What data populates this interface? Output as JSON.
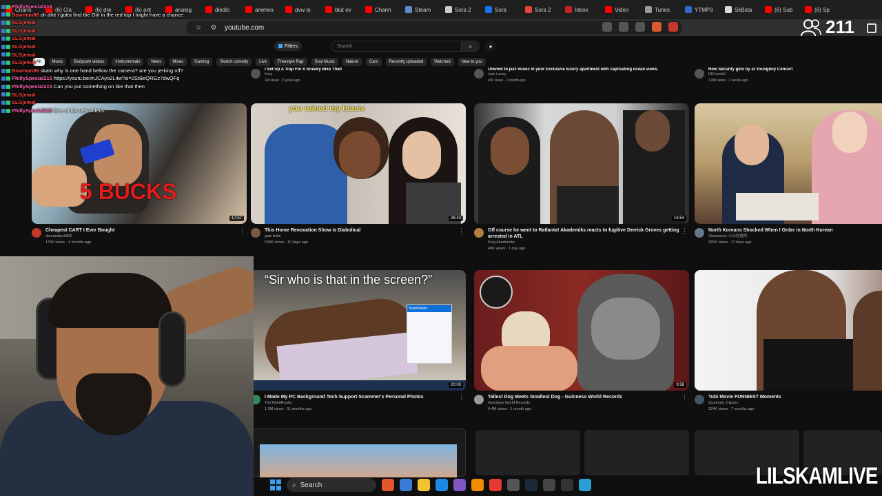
{
  "browser": {
    "tabs": [
      {
        "label": "Chann",
        "color": "#ff0000"
      },
      {
        "label": "(6) Cla",
        "color": "#ff0000"
      },
      {
        "label": "(6) dre",
        "color": "#ff0000"
      },
      {
        "label": "(6) ant",
        "color": "#ff0000"
      },
      {
        "label": "analog",
        "color": "#ff0000"
      },
      {
        "label": "diedlo",
        "color": "#ff0000"
      },
      {
        "label": "aneheo",
        "color": "#ff0000"
      },
      {
        "label": "dvw lo",
        "color": "#ff0000"
      },
      {
        "label": "blut ov",
        "color": "#ff0000"
      },
      {
        "label": "Chann",
        "color": "#ff0000"
      },
      {
        "label": "Steam",
        "color": "#5b8cc9"
      },
      {
        "label": "Sora 2",
        "color": "#cccccc"
      },
      {
        "label": "Sora",
        "color": "#1a73e8"
      },
      {
        "label": "Sora 2",
        "color": "#e6453a"
      },
      {
        "label": "Inbox",
        "color": "#c5221f"
      },
      {
        "label": "Video",
        "color": "#ff0000"
      },
      {
        "label": "Tunes",
        "color": "#999999"
      },
      {
        "label": "YTMP3",
        "color": "#3366cc"
      },
      {
        "label": "SkBsta",
        "color": "#dddddd"
      },
      {
        "label": "(6) Sub",
        "color": "#ff0000"
      },
      {
        "label": "(6) Sp",
        "color": "#ff0000"
      }
    ],
    "url": "youtube.com",
    "viewer_count": "211"
  },
  "youtube": {
    "filters_label": "Filters",
    "search_placeholder": "Search",
    "chips": [
      "All",
      "Music",
      "Bodycam videos",
      "Instrumentals",
      "News",
      "Mixes",
      "Gaming",
      "Sketch comedy",
      "Live",
      "Freestyle Rap",
      "Soul Music",
      "Nature",
      "Cars",
      "Recently uploaded",
      "Watched",
      "New to you"
    ],
    "partial_row": [
      {
        "title": "I Set Up A Trap For A Sneaky Bike Thief",
        "channel": "Kozy",
        "stats": "1M views · 2 years ago"
      },
      {
        "title": "Unwind to jazz music in your Exclusive luxury apartment with captivating ocean views",
        "channel": "Jazz Luxury",
        "stats": "450 views · 1 month ago"
      },
      {
        "title": "How Security gets by at Youngboy Concert",
        "channel": "RDCworld1",
        "stats": "1.8M views · 2 weeks ago"
      }
    ],
    "videos": [
      {
        "title": "Cheapest CART I Ever Bought",
        "channel": "damianduck925",
        "stats": "175K views · 4 months ago",
        "duration": "17:57",
        "overlay": "5 BUCKS",
        "avatar_color": "#c0392b"
      },
      {
        "title": "This Home Renovation Show is Diabolical",
        "channel": "gabi belle",
        "stats": "630K views · 10 days ago",
        "duration": "26:40",
        "overlay": "you ruined my house",
        "avatar_color": "#7a5a4a"
      },
      {
        "title": "Off course he went to Ratlanta! Akademiks reacts to fugitive Derrick Groves getting arrested in ATL",
        "channel": "King Akademiks",
        "stats": "49K views · 1 day ago",
        "duration": "16:54",
        "overlay": "",
        "avatar_color": "#b08040"
      },
      {
        "title": "North Koreans Shocked When I Order in North Korean",
        "channel": "Xiaomanyc 小马在纽约",
        "stats": "265K views · 11 days ago",
        "duration": "",
        "overlay": "",
        "avatar_color": "#667788"
      },
      {
        "title": "I Made My PC Background Tech Support Scammer's Personal Photos",
        "channel": "TheTekkitRealm",
        "stats": "1.9M views · 11 months ago",
        "duration": "20:03",
        "overlay": "“Sir who is that in the screen?”",
        "avatar_color": "#2e8b57"
      },
      {
        "title": "Tallest Dog Meets Smallest Dog - Guinness World Records",
        "channel": "Guinness World Records",
        "stats": "4.4M views · 1 month ago",
        "duration": "9:58",
        "overlay": "",
        "avatar_color": "#999999"
      },
      {
        "title": "Tubi Movie FUNNIEST Moments",
        "channel": "Quantum_Clipzzz",
        "stats": "334K views · 7 months ago",
        "duration": "",
        "overlay": "",
        "avatar_color": "#445566"
      }
    ],
    "teamviewer_label": "TeamViewer"
  },
  "chat": [
    {
      "user": "PhillySpecial215",
      "color": "#ff69b4",
      "msg": ""
    },
    {
      "user": "Bowman86",
      "color": "#ff4444",
      "msg": "oh ahit I gotta find the Girl in the red top I might have a chance"
    },
    {
      "user": "SLGjemal",
      "color": "#ff4444",
      "msg": ""
    },
    {
      "user": "SLGjemal",
      "color": "#ff4444",
      "msg": ""
    },
    {
      "user": "SLGjemal",
      "color": "#ff4444",
      "msg": ""
    },
    {
      "user": "SLGjemal",
      "color": "#ff4444",
      "msg": ""
    },
    {
      "user": "SLGjemal",
      "color": "#ff4444",
      "msg": ""
    },
    {
      "user": "SLGjemal",
      "color": "#ff4444",
      "msg": ""
    },
    {
      "user": "Bowman86",
      "color": "#ff4444",
      "msg": "skam why is one hand bellow the camera? are you jerking off?"
    },
    {
      "user": "PhillySpecial215",
      "color": "#ff69b4",
      "msg": "https://youtu.be/mJCAyo2Litw?si=2StBeQRGz7dwQFq"
    },
    {
      "user": "PhillySpecial215",
      "color": "#ff69b4",
      "msg": "Can you put something on like that then"
    },
    {
      "user": "SLGjemal",
      "color": "#ff4444",
      "msg": ""
    },
    {
      "user": "SLGjemal",
      "color": "#ff4444",
      "msg": ""
    },
    {
      "user": "PhillySpecial215",
      "color": "#ff69b4",
      "msg": "One of his new videos"
    }
  ],
  "taskbar": {
    "search_label": "Search",
    "apps": [
      "#e4572e",
      "#3a7bd5",
      "#f4c430",
      "#1e88e5",
      "#7e57c2",
      "#f28b00",
      "#e53935",
      "#555555",
      "#1b2838",
      "#444444",
      "#333333",
      "#2a9fd6"
    ]
  },
  "brand_text": "LILSKAMLIVE"
}
